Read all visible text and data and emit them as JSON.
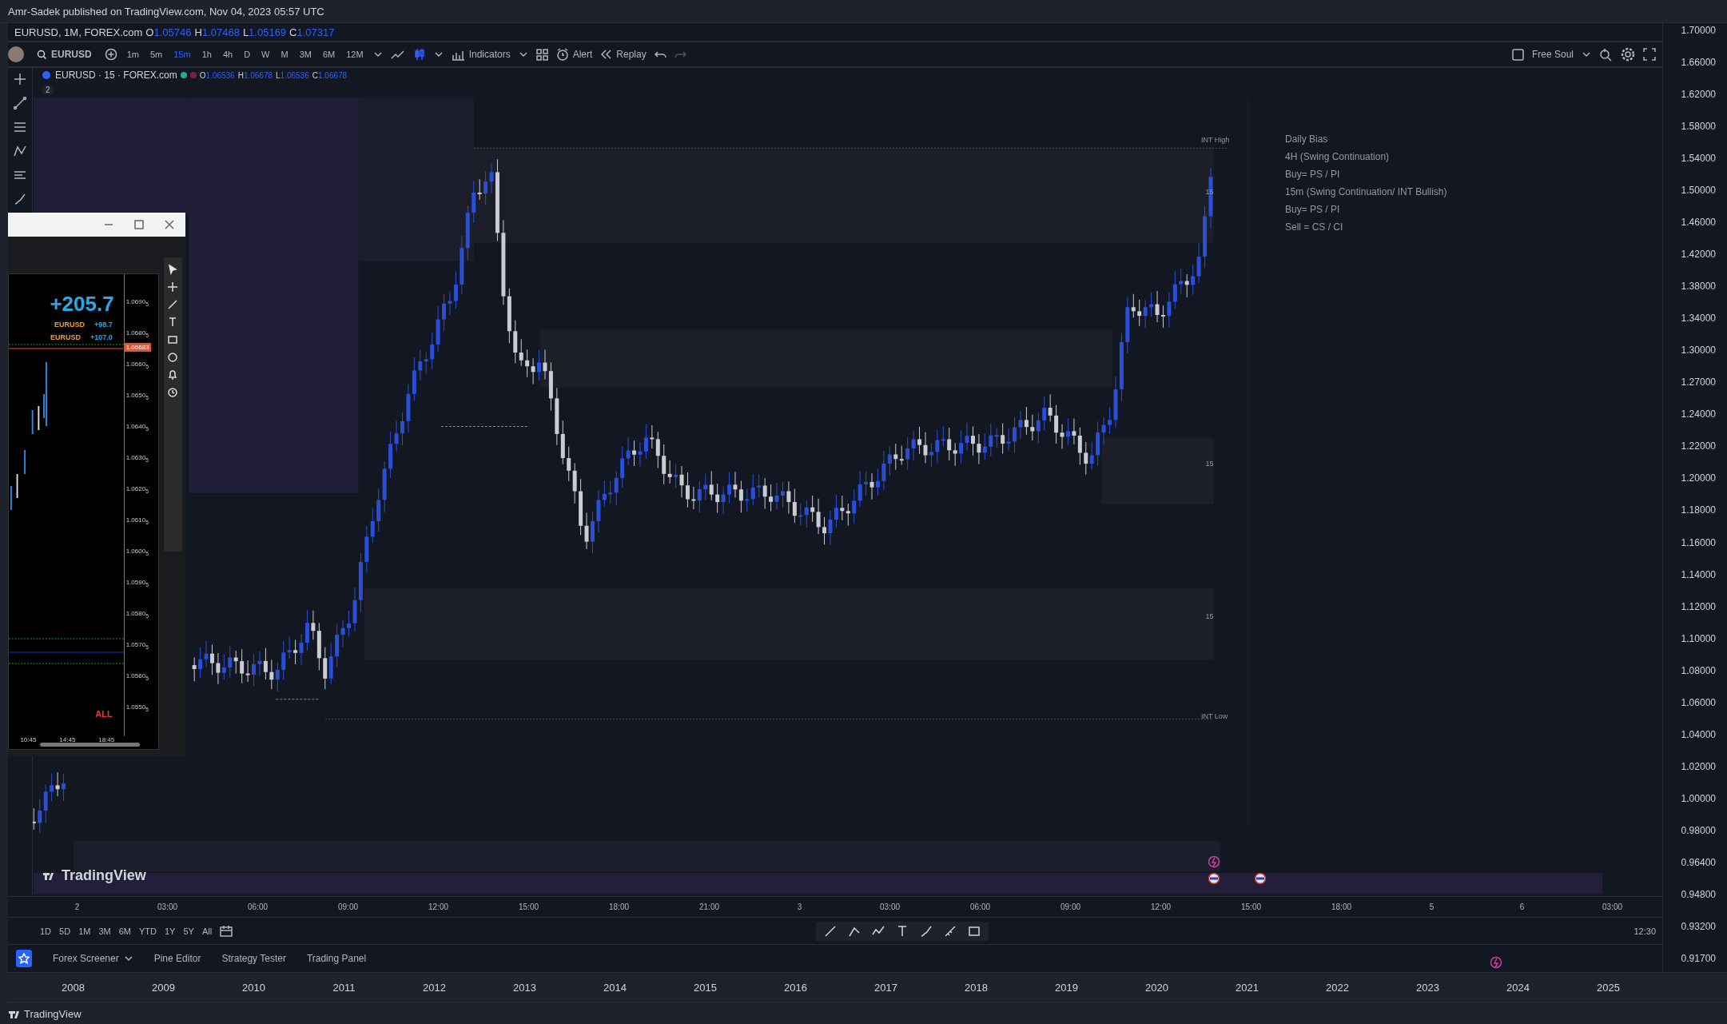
{
  "header": {
    "text": "Amr-Sadek published on TradingView.com, Nov 04, 2023 05:57 UTC"
  },
  "legend": {
    "symbol": "EURUSD, 1M, FOREX.com",
    "values": [
      {
        "label": "O",
        "value": "1.05746"
      },
      {
        "label": "H",
        "value": "1.07468"
      },
      {
        "label": "L",
        "value": "1.05169"
      },
      {
        "label": "C",
        "value": "1.07317"
      }
    ]
  },
  "toolbar": {
    "symbol": "EURUSD",
    "intervals": [
      {
        "label": "1m",
        "selected": false
      },
      {
        "label": "5m",
        "selected": false
      },
      {
        "label": "15m",
        "selected": true
      },
      {
        "label": "1h",
        "selected": false
      },
      {
        "label": "4h",
        "selected": false
      },
      {
        "label": "D",
        "selected": false
      },
      {
        "label": "W",
        "selected": false
      },
      {
        "label": "M",
        "selected": false
      },
      {
        "label": "3M",
        "selected": false
      },
      {
        "label": "6M",
        "selected": false
      },
      {
        "label": "12M",
        "selected": false
      }
    ],
    "indicators": "Indicators",
    "alert": "Alert",
    "replay": "Replay",
    "layout": "Free Soul"
  },
  "chart": {
    "title": "EURUSD · 15 · FOREX.com",
    "values": [
      {
        "label": "O",
        "value": "1.06536"
      },
      {
        "label": "H",
        "value": "1.06678"
      },
      {
        "label": "L",
        "value": "1.06536"
      },
      {
        "label": "C",
        "value": "1.06678"
      }
    ],
    "collapse": "2",
    "high_label": "INT High",
    "low_label": "INT Low",
    "zone_labels": [
      "15",
      "15",
      "15"
    ],
    "notes": [
      "Daily Bias",
      "4H (Swing Continuation)",
      "Buy= PS / PI",
      "15m (Swing Continuation/ INT Bullish)",
      "Buy= PS / PI",
      "Sell = CS / CI"
    ],
    "logo": "TradingView"
  },
  "recording": {
    "total": "+205.7",
    "rows": [
      {
        "symbol": "EURUSD",
        "value": "+98.7"
      },
      {
        "symbol": "EURUSD",
        "value": "+107.0"
      }
    ],
    "prices": [
      "1.0690$_{5}$",
      "1.0680$_{5}$",
      "1.0660$_{5}$",
      "1.0650$_{5}$",
      "1.0640$_{5}$",
      "1.0630$_{5}$",
      "1.0620$_{5}$",
      "1.0610$_{5}$",
      "1.0600$_{5}$",
      "1.0590$_{5}$",
      "1.0580$_{5}$",
      "1.0570$_{5}$",
      "1.0560$_{5}$",
      "1.0550$_{5}$"
    ],
    "price_tag": "1.06683",
    "mode": "ALL",
    "times": [
      "10:45",
      "14:45",
      "18:45"
    ]
  },
  "time_axis": {
    "labels": [
      "2",
      "03:00",
      "06:00",
      "09:00",
      "12:00",
      "15:00",
      "18:00",
      "21:00",
      "3",
      "03:00",
      "06:00",
      "09:00",
      "12:00",
      "15:00",
      "18:00",
      "5",
      "6",
      "03:00"
    ],
    "clock": "12:30"
  },
  "ranges": [
    "1D",
    "5D",
    "1M",
    "3M",
    "6M",
    "YTD",
    "1Y",
    "5Y",
    "All"
  ],
  "tabs": [
    {
      "label": "Forex Screener",
      "menu": true
    },
    {
      "label": "Pine Editor",
      "menu": false
    },
    {
      "label": "Strategy Tester",
      "menu": false
    },
    {
      "label": "Trading Panel",
      "menu": false
    }
  ],
  "price_axis": [
    "1.70000",
    "1.66000",
    "1.62000",
    "1.58000",
    "1.54000",
    "1.50000",
    "1.46000",
    "1.42000",
    "1.38000",
    "1.34000",
    "1.30000",
    "1.27000",
    "1.24000",
    "1.22000",
    "1.20000",
    "1.18000",
    "1.16000",
    "1.14000",
    "1.12000",
    "1.10000",
    "1.08000",
    "1.06000",
    "1.04000",
    "1.02000",
    "1.00000",
    "0.98000",
    "0.96400",
    "0.94800",
    "0.93200",
    "0.91700"
  ],
  "years": [
    "2008",
    "2009",
    "2010",
    "2011",
    "2012",
    "2013",
    "2014",
    "2015",
    "2016",
    "2017",
    "2018",
    "2019",
    "2020",
    "2021",
    "2022",
    "2023",
    "2024",
    "2025"
  ],
  "footer": "TradingView"
}
